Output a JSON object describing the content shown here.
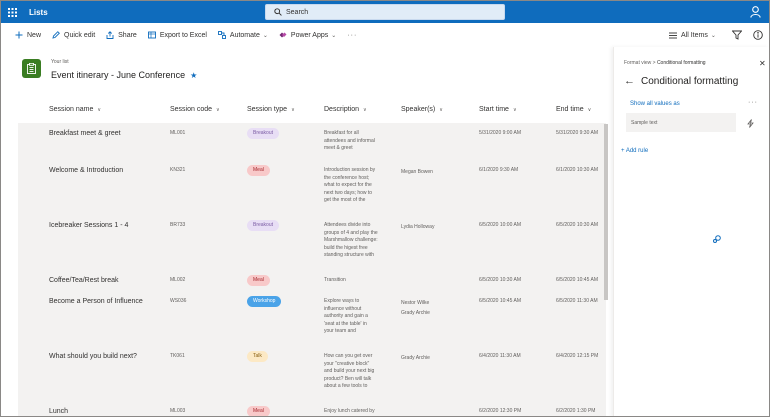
{
  "suite": {
    "app_title": "Lists",
    "search_placeholder": "Search"
  },
  "commands": {
    "new": "New",
    "quick_edit": "Quick edit",
    "share": "Share",
    "export": "Export to Excel",
    "automate": "Automate",
    "power_apps": "Power Apps",
    "more": "···",
    "view": "All Items"
  },
  "list": {
    "eyebrow": "Your list",
    "title": "Event itinerary - June Conference"
  },
  "columns": [
    "Session name",
    "Session code",
    "Session type",
    "Description",
    "Speaker(s)",
    "Start time",
    "End time"
  ],
  "rows": [
    {
      "name": "Breakfast meet & greet",
      "code": "ML001",
      "type": "Breakout",
      "type_style": "breakout",
      "desc": [
        "Breakfast for all",
        "attendees and informal",
        "meet & greet"
      ],
      "speakers": [],
      "start": "5/31/2020 9:00 AM",
      "end": "5/31/2020 9:30 AM"
    },
    {
      "name": "Welcome & Introduction",
      "code": "KN321",
      "type": "Meal",
      "type_style": "meal",
      "desc": [
        "Introduction session by",
        "the conference host;",
        "what to expect for the",
        "next two days; how to",
        "get the most of the"
      ],
      "speakers": [
        "Megan Bowen"
      ],
      "start": "6/1/2020 9:30 AM",
      "end": "6/1/2020 10:30 AM"
    },
    {
      "name": "Icebreaker Sessions 1 - 4",
      "code": "BR733",
      "type": "Breakout",
      "type_style": "breakout",
      "desc": [
        "Attendees divide into",
        "groups of 4 and play the",
        "Marshmallow challenge:",
        "build the higest free",
        "standing structure with"
      ],
      "speakers": [
        "Lydia Holloway"
      ],
      "start": "6/5/2020 10:00 AM",
      "end": "6/5/2020 10:30 AM"
    },
    {
      "name": "Coffee/Tea/Rest break",
      "code": "ML002",
      "type": "Meal",
      "type_style": "meal",
      "desc": [
        "Transition"
      ],
      "speakers": [],
      "start": "6/5/2020 10:30 AM",
      "end": "6/5/2020 10:45 AM"
    },
    {
      "name": "Become a Person of Influence",
      "code": "WS036",
      "type": "Workshop",
      "type_style": "workshop",
      "desc": [
        "Explore ways to",
        "influence without",
        "authority and gain a",
        "'seat at the table' in",
        "your team and"
      ],
      "speakers": [
        "Nestor Wilke",
        "Grady Archie"
      ],
      "start": "6/5/2020 10:45 AM",
      "end": "6/5/2020 11:30 AM"
    },
    {
      "name": "What should you build next?",
      "code": "TK061",
      "type": "Talk",
      "type_style": "talk",
      "desc": [
        "How can you get over",
        "your \"creative block\"",
        "and build your next big",
        "product? Ben will talk",
        "about a few tools to"
      ],
      "speakers": [
        "Grady Archie"
      ],
      "start": "6/4/2020 11:30 AM",
      "end": "6/4/2020 12:15 PM"
    },
    {
      "name": "Lunch",
      "code": "ML003",
      "type": "Meal",
      "type_style": "meal",
      "desc": [
        "Enjoy lunch catered by"
      ],
      "speakers": [],
      "start": "6/2/2020 12:30 PM",
      "end": "6/2/2020 1:30 PM"
    }
  ],
  "pill_colors": {
    "breakout": {
      "bg": "#e8def5",
      "fg": "#7a5ba3"
    },
    "meal": {
      "bg": "#f8c9c9",
      "fg": "#a4262c"
    },
    "workshop": {
      "bg": "#4aa3e8",
      "fg": "#ffffff"
    },
    "talk": {
      "bg": "#fce9c5",
      "fg": "#8a6114"
    }
  },
  "pane": {
    "crumb_parent": "Format view",
    "crumb_sep": ">",
    "crumb_current": "Conditional formatting",
    "title": "Conditional formatting",
    "show_all": "Show all values as",
    "more": "···",
    "sample": "Sample text",
    "add_rule": "+ Add rule"
  },
  "colors": {
    "brand": "#0f6cbd",
    "list_icon": "#3a7d22"
  }
}
